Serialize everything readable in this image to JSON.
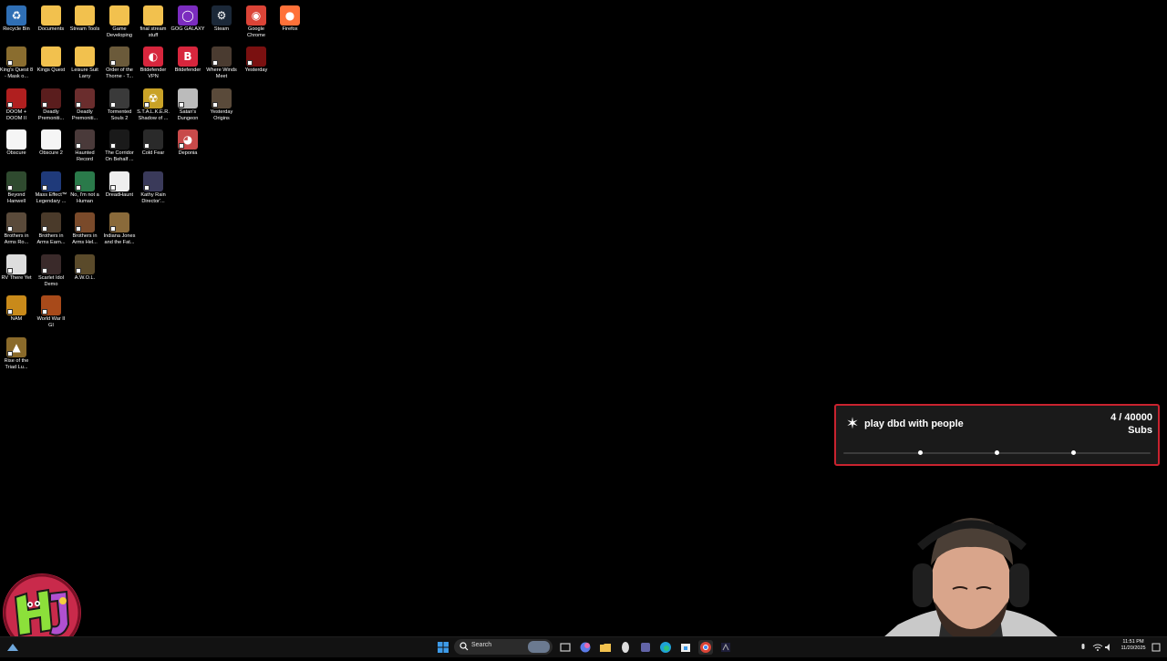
{
  "desktop": {
    "icons": [
      {
        "label": "Recycle Bin",
        "icon": "recycle-bin-icon",
        "color": "#2f6fb5",
        "glyph": "♻"
      },
      {
        "label": "Documents",
        "icon": "folder-icon",
        "color": "#f2c14e",
        "glyph": ""
      },
      {
        "label": "Stream Tools",
        "icon": "folder-icon",
        "color": "#f2c14e",
        "glyph": ""
      },
      {
        "label": "Game Developing",
        "icon": "folder-icon",
        "color": "#f2c14e",
        "glyph": ""
      },
      {
        "label": "final stream stuff",
        "icon": "folder-icon",
        "color": "#f2c14e",
        "glyph": ""
      },
      {
        "label": "GOG GALAXY",
        "icon": "gog-galaxy-icon",
        "color": "#7b2cbf",
        "glyph": "◯"
      },
      {
        "label": "Steam",
        "icon": "steam-icon",
        "color": "#1b2838",
        "glyph": "⚙"
      },
      {
        "label": "Google Chrome",
        "icon": "chrome-icon",
        "color": "#db4437",
        "glyph": "◉"
      },
      {
        "label": "Firefox",
        "icon": "firefox-icon",
        "color": "#ff7139",
        "glyph": "●"
      },
      {
        "label": "King's Quest 8 - Mask o...",
        "icon": "game-shortcut-icon",
        "color": "#8a6d2f",
        "glyph": ""
      },
      {
        "label": "Kings Quest",
        "icon": "folder-icon",
        "color": "#f2c14e",
        "glyph": ""
      },
      {
        "label": "Leisure Suit Larry",
        "icon": "folder-icon",
        "color": "#f2c14e",
        "glyph": ""
      },
      {
        "label": "Order of the Thorne - T...",
        "icon": "game-shortcut-icon",
        "color": "#6b5a3a",
        "glyph": ""
      },
      {
        "label": "Bitdefender VPN",
        "icon": "bitdefender-vpn-icon",
        "color": "#d7263d",
        "glyph": "◐"
      },
      {
        "label": "Bitdefender",
        "icon": "bitdefender-icon",
        "color": "#d7263d",
        "glyph": "B"
      },
      {
        "label": "Where Winds Meet",
        "icon": "game-shortcut-icon",
        "color": "#4a3b30",
        "glyph": ""
      },
      {
        "label": "Yesterday",
        "icon": "game-shortcut-icon",
        "color": "#7a1010",
        "glyph": ""
      },
      {
        "label": "DOOM + DOOM II",
        "icon": "game-shortcut-icon",
        "color": "#b01f1f",
        "glyph": ""
      },
      {
        "label": "Deadly Premoniti...",
        "icon": "game-shortcut-icon",
        "color": "#5a1d1d",
        "glyph": ""
      },
      {
        "label": "Deadly Premoniti...",
        "icon": "game-shortcut-icon",
        "color": "#6a2d2d",
        "glyph": ""
      },
      {
        "label": "Tormented Souls 2",
        "icon": "game-shortcut-icon",
        "color": "#3a3a3a",
        "glyph": ""
      },
      {
        "label": "S.T.A.L.K.E.R. Shadow of ...",
        "icon": "game-shortcut-icon",
        "color": "#c9a227",
        "glyph": "☢"
      },
      {
        "label": "Satan's Dungeon",
        "icon": "game-shortcut-icon",
        "color": "#bbbbbb",
        "glyph": ""
      },
      {
        "label": "Yesterday Origins",
        "icon": "game-shortcut-icon",
        "color": "#5a4a3a",
        "glyph": ""
      },
      {
        "label": "Obscure",
        "icon": "file-icon",
        "color": "#f5f5f5",
        "glyph": ""
      },
      {
        "label": "Obscure 2",
        "icon": "file-icon",
        "color": "#f5f5f5",
        "glyph": ""
      },
      {
        "label": "Haunted Record",
        "icon": "game-shortcut-icon",
        "color": "#4a3a3a",
        "glyph": ""
      },
      {
        "label": "The Corridor On Behalf ...",
        "icon": "game-shortcut-icon",
        "color": "#1a1a1a",
        "glyph": ""
      },
      {
        "label": "Cold Fear",
        "icon": "game-shortcut-icon",
        "color": "#2a2a2a",
        "glyph": ""
      },
      {
        "label": "Deponia",
        "icon": "game-shortcut-icon",
        "color": "#c84a4a",
        "glyph": "◕"
      },
      {
        "label": "Beyond Hanwell",
        "icon": "game-shortcut-icon",
        "color": "#2f4a2f",
        "glyph": ""
      },
      {
        "label": "Mass Effect™ Legendary ...",
        "icon": "game-shortcut-icon",
        "color": "#1f3a7a",
        "glyph": ""
      },
      {
        "label": "No, I'm not a Human",
        "icon": "game-shortcut-icon",
        "color": "#2a7a4a",
        "glyph": ""
      },
      {
        "label": "DreadHaunt",
        "icon": "game-shortcut-icon",
        "color": "#eeeeee",
        "glyph": ""
      },
      {
        "label": "Kathy Rain Director'...",
        "icon": "game-shortcut-icon",
        "color": "#3a3a5a",
        "glyph": ""
      },
      {
        "label": "Brothers in Arms Ro...",
        "icon": "game-shortcut-icon",
        "color": "#5a4a3a",
        "glyph": ""
      },
      {
        "label": "Brothers in Arms Earn...",
        "icon": "game-shortcut-icon",
        "color": "#4a3a2a",
        "glyph": ""
      },
      {
        "label": "Brothers in Arms Hel...",
        "icon": "game-shortcut-icon",
        "color": "#7a4a2a",
        "glyph": ""
      },
      {
        "label": "Indiana Jones and the Fat...",
        "icon": "game-shortcut-icon",
        "color": "#8a6a3a",
        "glyph": ""
      },
      {
        "label": "RV There Yet",
        "icon": "game-shortcut-icon",
        "color": "#dddddd",
        "glyph": ""
      },
      {
        "label": "Scarlet Idol Demo",
        "icon": "game-shortcut-icon",
        "color": "#3a2a2a",
        "glyph": ""
      },
      {
        "label": "A.W.O.L.",
        "icon": "game-shortcut-icon",
        "color": "#5a4a2a",
        "glyph": ""
      },
      {
        "label": "NAM",
        "icon": "game-shortcut-icon",
        "color": "#c98a1a",
        "glyph": ""
      },
      {
        "label": "World War II GI",
        "icon": "game-shortcut-icon",
        "color": "#a84a1a",
        "glyph": ""
      },
      {
        "label": "Rise of the Triad Lu...",
        "icon": "game-shortcut-icon",
        "color": "#8a6a2a",
        "glyph": "▲"
      }
    ]
  },
  "goal": {
    "title": "play dbd with people",
    "count": "4 / 40000",
    "unit": "Subs",
    "progress_fraction": 0.0001,
    "milestones_fraction": [
      0.25,
      0.5,
      0.75
    ],
    "icon": "star-icon",
    "accent": "#c9232f"
  },
  "taskbar": {
    "search_label": "Search",
    "clock_time": "11:51 PM",
    "clock_date": "11/20/2025",
    "pinned": [
      "start-icon",
      "task-view-icon",
      "copilot-icon",
      "alienware-icon",
      "file-explorer-icon",
      "store-icon",
      "teams-icon",
      "edge-icon",
      "chrome-icon",
      "obs-icon",
      "app-icon"
    ],
    "tray": [
      "chevron-up-icon",
      "microphone-icon",
      "wifi-icon",
      "volume-icon",
      "notification-icon"
    ]
  }
}
